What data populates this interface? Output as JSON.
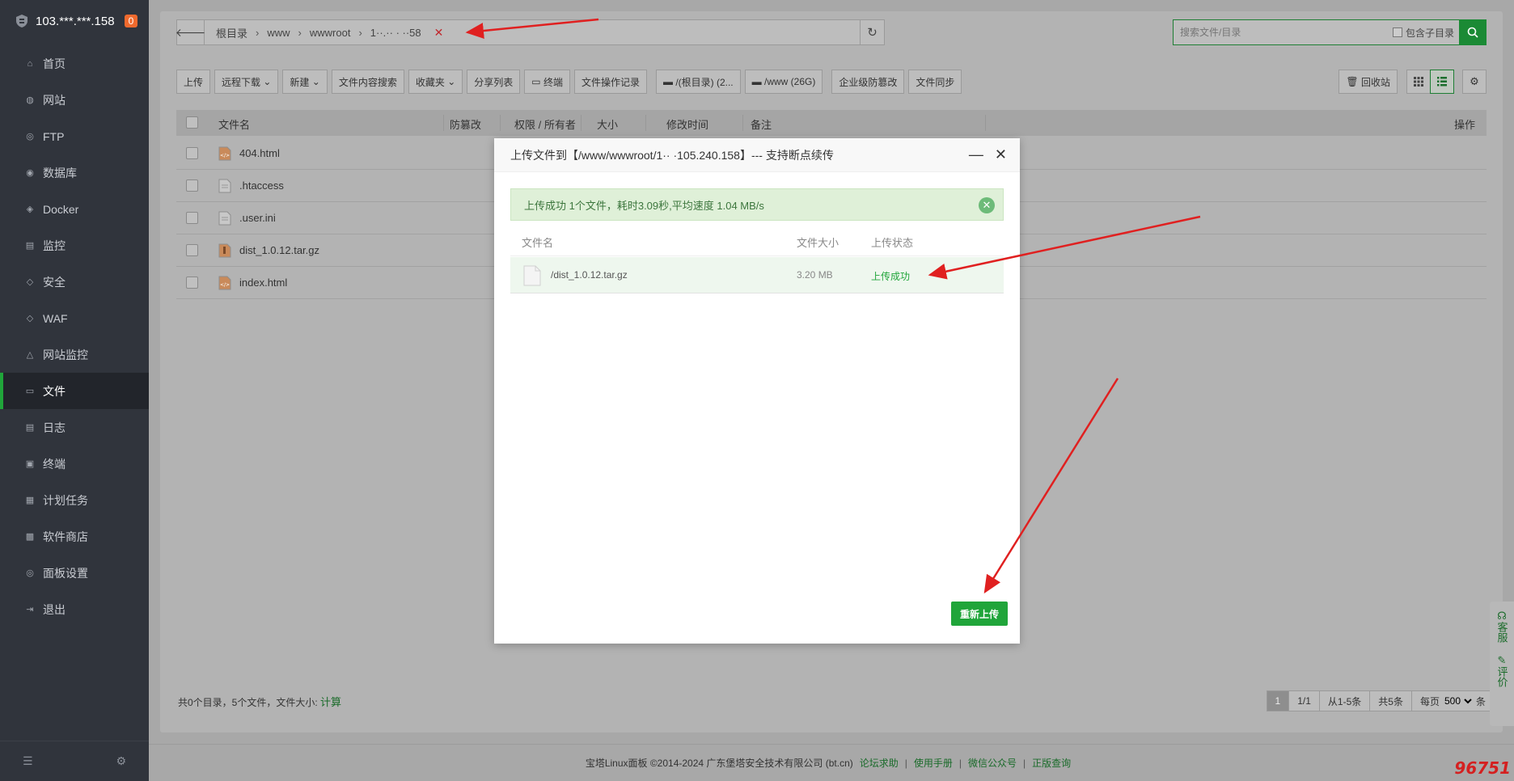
{
  "server": {
    "ip": "103.***.***.158",
    "badge": "0"
  },
  "sidebar": {
    "items": [
      {
        "label": "首页",
        "icon": "home-icon"
      },
      {
        "label": "网站",
        "icon": "globe-icon"
      },
      {
        "label": "FTP",
        "icon": "ftp-icon"
      },
      {
        "label": "数据库",
        "icon": "database-icon"
      },
      {
        "label": "Docker",
        "icon": "docker-icon"
      },
      {
        "label": "监控",
        "icon": "monitor-icon"
      },
      {
        "label": "安全",
        "icon": "shield-icon"
      },
      {
        "label": "WAF",
        "icon": "waf-icon"
      },
      {
        "label": "网站监控",
        "icon": "site-monitor-icon"
      },
      {
        "label": "文件",
        "icon": "folder-icon"
      },
      {
        "label": "日志",
        "icon": "log-icon"
      },
      {
        "label": "终端",
        "icon": "terminal-icon"
      },
      {
        "label": "计划任务",
        "icon": "calendar-icon"
      },
      {
        "label": "软件商店",
        "icon": "store-icon"
      },
      {
        "label": "面板设置",
        "icon": "settings-icon"
      },
      {
        "label": "退出",
        "icon": "logout-icon"
      }
    ],
    "active_index": 9
  },
  "path": {
    "crumbs": [
      "根目录",
      "www",
      "wwwroot",
      "1··.·· ·  ··58"
    ]
  },
  "search": {
    "placeholder": "搜索文件/目录",
    "include_subdir": "包含子目录"
  },
  "toolbar": {
    "upload": "上传",
    "remote_download": "远程下载",
    "new": "新建",
    "content_search": "文件内容搜索",
    "favorites": "收藏夹",
    "share_list": "分享列表",
    "terminal": "终端",
    "op_log": "文件操作记录",
    "disk_root": "/(根目录) (2...",
    "disk_www": "/www (26G)",
    "tamper": "企业级防篡改",
    "sync": "文件同步",
    "recycle": "回收站"
  },
  "table": {
    "headers": {
      "name": "文件名",
      "tamper": "防篡改",
      "perm": "权限 / 所有者",
      "size": "大小",
      "mtime": "修改时间",
      "note": "备注",
      "ops": "操作"
    },
    "rows": [
      {
        "name": "404.html",
        "type": "html"
      },
      {
        "name": ".htaccess",
        "type": "text"
      },
      {
        "name": ".user.ini",
        "type": "text"
      },
      {
        "name": "dist_1.0.12.tar.gz",
        "type": "archive"
      },
      {
        "name": "index.html",
        "type": "html"
      }
    ]
  },
  "summary": {
    "text": "共0个目录，5个文件，文件大小: ",
    "calc": "计算"
  },
  "pager": {
    "current": "1",
    "pages": "1/1",
    "range": "从1-5条",
    "total": "共5条",
    "per_page_label": "每页",
    "per_page": "500",
    "unit": "条"
  },
  "footer": {
    "copyright": "宝塔Linux面板 ©2014-2024 广东堡塔安全技术有限公司 (bt.cn)",
    "links": [
      "论坛求助",
      "使用手册",
      "微信公众号",
      "正版查询"
    ]
  },
  "float": {
    "service": "客服",
    "review": "评价"
  },
  "modal": {
    "title": "上传文件到【/www/wwwroot/1·· ·105.240.158】--- 支持断点续传",
    "alert": "上传成功 1个文件，耗时3.09秒,平均速度 1.04 MB/s",
    "headers": {
      "name": "文件名",
      "size": "文件大小",
      "status": "上传状态"
    },
    "file": {
      "name": "/dist_1.0.12.tar.gz",
      "size": "3.20 MB",
      "status": "上传成功"
    },
    "reupload": "重新上传"
  },
  "watermark": "96751",
  "colors": {
    "accent": "#20a53a",
    "sidebar": "#30343c",
    "arrow": "#e02020"
  }
}
